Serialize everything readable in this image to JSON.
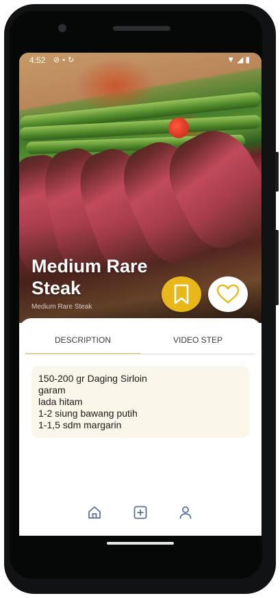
{
  "status_bar": {
    "time": "4:52",
    "left_icons": [
      "do-not-disturb-icon",
      "sim-icon",
      "sync-icon"
    ],
    "right_icons": [
      "wifi-icon",
      "signal-icon",
      "battery-icon"
    ]
  },
  "recipe": {
    "title": "Medium Rare Steak",
    "subtitle": "Medium Rare Steak"
  },
  "actions": {
    "bookmark_icon": "bookmark-icon",
    "like_icon": "heart-icon"
  },
  "tabs": [
    {
      "label": "DESCRIPTION",
      "active": true
    },
    {
      "label": "VIDEO STEP",
      "active": false
    }
  ],
  "ingredients": [
    "150-200 gr Daging Sirloin",
    "garam",
    "lada hitam",
    "1-2 siung bawang putih",
    "1-1,5 sdm margarin"
  ],
  "bottom_nav": [
    {
      "icon": "home-icon"
    },
    {
      "icon": "add-icon"
    },
    {
      "icon": "profile-icon"
    }
  ],
  "colors": {
    "accent": "#e8b81b",
    "nav_icon": "#5b6e9c",
    "card_bg": "#faf6ea",
    "tab_indicator": "#e8c25a"
  }
}
